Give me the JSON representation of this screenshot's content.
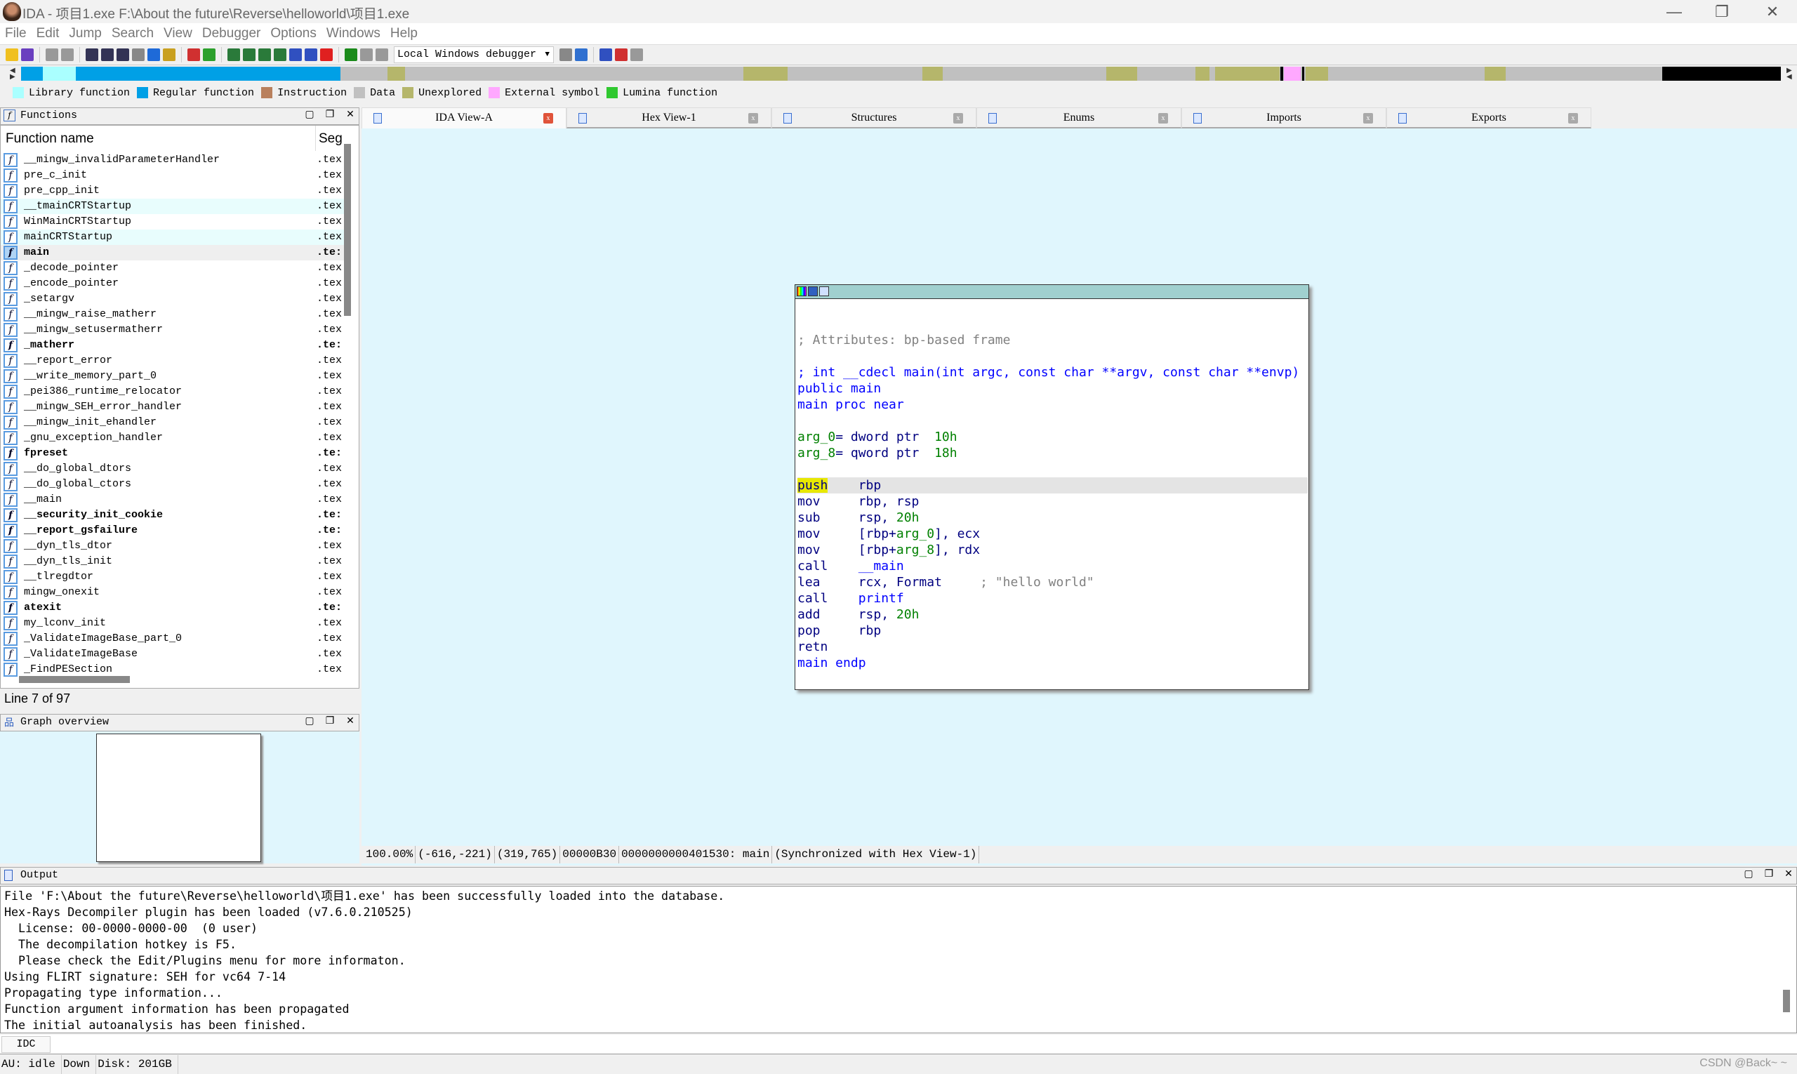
{
  "window": {
    "title": "IDA - 项目1.exe F:\\About the future\\Reverse\\helloworld\\项目1.exe",
    "minimize": "—",
    "restore": "❐",
    "close": "✕"
  },
  "menu": [
    "File",
    "Edit",
    "Jump",
    "Search",
    "View",
    "Debugger",
    "Options",
    "Windows",
    "Help"
  ],
  "toolbar": {
    "debugger_select": "Local Windows debugger",
    "icons": [
      {
        "name": "open-icon",
        "color": "#f0c020"
      },
      {
        "name": "save-icon",
        "color": "#6a3fbf"
      },
      {
        "sep": true
      },
      {
        "name": "back-icon",
        "color": "#999"
      },
      {
        "name": "forward-icon",
        "color": "#999"
      },
      {
        "sep": true
      },
      {
        "name": "text-search-icon",
        "color": "#335"
      },
      {
        "name": "binary-search-icon",
        "color": "#335"
      },
      {
        "name": "immediate-search-icon",
        "color": "#335"
      },
      {
        "name": "search-next-icon",
        "color": "#888"
      },
      {
        "name": "jump-down-icon",
        "color": "#1e6ad8"
      },
      {
        "name": "find-icon",
        "color": "#c9a020"
      },
      {
        "sep": true
      },
      {
        "name": "strings-icon",
        "color": "#d03030"
      },
      {
        "name": "run-icon",
        "color": "#2ca02c"
      },
      {
        "sep": true
      },
      {
        "name": "make-code-icon",
        "color": "#2a7a3a"
      },
      {
        "name": "make-data-icon",
        "color": "#2a7a3a"
      },
      {
        "name": "make-ascii-icon",
        "color": "#2a7a3a"
      },
      {
        "name": "make-array-icon",
        "color": "#2a7a3a"
      },
      {
        "name": "define-struct-icon",
        "color": "#3050c0"
      },
      {
        "name": "edit-icon",
        "color": "#3050c0"
      },
      {
        "name": "undefine-icon",
        "color": "#e02020"
      },
      {
        "sep": true
      },
      {
        "name": "play-icon",
        "color": "#1a8a1a"
      },
      {
        "name": "pause-icon",
        "color": "#999"
      },
      {
        "name": "stop-icon",
        "color": "#999"
      }
    ],
    "icons_right": [
      {
        "name": "attach-icon",
        "color": "#888"
      },
      {
        "name": "step-icon",
        "color": "#3070d0"
      },
      {
        "sep": true
      },
      {
        "name": "breakpoints-icon",
        "color": "#3050c0"
      },
      {
        "name": "add-breakpoint-icon",
        "color": "#d03030"
      },
      {
        "name": "delete-breakpoint-icon",
        "color": "#999"
      }
    ]
  },
  "legend": [
    {
      "label": "Library function",
      "color": "#aaffff"
    },
    {
      "label": "Regular function",
      "color": "#00a0e6"
    },
    {
      "label": "Instruction",
      "color": "#b9805d"
    },
    {
      "label": "Data",
      "color": "#c0c0c0"
    },
    {
      "label": "Unexplored",
      "color": "#b5b66b"
    },
    {
      "label": "External symbol",
      "color": "#ffa8ff"
    },
    {
      "label": "Lumina function",
      "color": "#30c830"
    }
  ],
  "functions": {
    "title": "Functions",
    "col_name": "Function name",
    "col_seg": "Seg",
    "status": "Line 7 of 97",
    "rows": [
      {
        "name": "__mingw_invalidParameterHandler",
        "seg": ".tex"
      },
      {
        "name": "pre_c_init",
        "seg": ".tex"
      },
      {
        "name": "pre_cpp_init",
        "seg": ".tex"
      },
      {
        "name": "__tmainCRTStartup",
        "seg": ".tex",
        "lib": true
      },
      {
        "name": "WinMainCRTStartup",
        "seg": ".tex"
      },
      {
        "name": "mainCRTStartup",
        "seg": ".tex",
        "lib": true
      },
      {
        "name": "main",
        "seg": ".te:",
        "bold": true,
        "selected": true
      },
      {
        "name": "_decode_pointer",
        "seg": ".tex"
      },
      {
        "name": "_encode_pointer",
        "seg": ".tex"
      },
      {
        "name": "_setargv",
        "seg": ".tex"
      },
      {
        "name": "__mingw_raise_matherr",
        "seg": ".tex"
      },
      {
        "name": "__mingw_setusermatherr",
        "seg": ".tex"
      },
      {
        "name": "_matherr",
        "seg": ".te:",
        "bold": true
      },
      {
        "name": "__report_error",
        "seg": ".tex"
      },
      {
        "name": "__write_memory_part_0",
        "seg": ".tex"
      },
      {
        "name": "_pei386_runtime_relocator",
        "seg": ".tex"
      },
      {
        "name": "__mingw_SEH_error_handler",
        "seg": ".tex"
      },
      {
        "name": "__mingw_init_ehandler",
        "seg": ".tex"
      },
      {
        "name": "_gnu_exception_handler",
        "seg": ".tex"
      },
      {
        "name": "fpreset",
        "seg": ".te:",
        "bold": true
      },
      {
        "name": "__do_global_dtors",
        "seg": ".tex"
      },
      {
        "name": "__do_global_ctors",
        "seg": ".tex"
      },
      {
        "name": "__main",
        "seg": ".tex"
      },
      {
        "name": "__security_init_cookie",
        "seg": ".te:",
        "bold": true
      },
      {
        "name": "__report_gsfailure",
        "seg": ".te:",
        "bold": true
      },
      {
        "name": "__dyn_tls_dtor",
        "seg": ".tex"
      },
      {
        "name": "__dyn_tls_init",
        "seg": ".tex"
      },
      {
        "name": "__tlregdtor",
        "seg": ".tex"
      },
      {
        "name": "mingw_onexit",
        "seg": ".tex"
      },
      {
        "name": "atexit",
        "seg": ".te:",
        "bold": true
      },
      {
        "name": "my_lconv_init",
        "seg": ".tex"
      },
      {
        "name": "_ValidateImageBase_part_0",
        "seg": ".tex"
      },
      {
        "name": "_ValidateImageBase",
        "seg": ".tex"
      },
      {
        "name": "_FindPESection",
        "seg": ".tex"
      }
    ]
  },
  "graph_overview": {
    "title": "Graph overview"
  },
  "tabs": [
    {
      "label": "IDA View-A",
      "active": true
    },
    {
      "label": "Hex View-1"
    },
    {
      "label": "Structures"
    },
    {
      "label": "Enums"
    },
    {
      "label": "Imports"
    },
    {
      "label": "Exports"
    }
  ],
  "tab_close": "x",
  "code": [
    [],
    [],
    [
      {
        "t": "; Attributes: bp-based frame",
        "c": "cm"
      }
    ],
    [],
    [
      {
        "t": "; int __cdecl main(int argc, const char **argv, const char **envp)",
        "c": "bl"
      }
    ],
    [
      {
        "t": "public main",
        "c": "bl"
      }
    ],
    [
      {
        "t": "main proc near",
        "c": "bl"
      }
    ],
    [],
    [
      {
        "t": "arg_0",
        "c": "gr"
      },
      {
        "t": "= dword ptr  ",
        "c": "k"
      },
      {
        "t": "10h",
        "c": "gr"
      }
    ],
    [
      {
        "t": "arg_8",
        "c": "gr"
      },
      {
        "t": "= qword ptr  ",
        "c": "k"
      },
      {
        "t": "18h",
        "c": "gr"
      }
    ],
    [],
    [
      {
        "t": "push",
        "c": "hl"
      },
      {
        "t": "    rbp",
        "c": "k"
      }
    ],
    [
      {
        "t": "mov     rbp, rsp",
        "c": "k"
      }
    ],
    [
      {
        "t": "sub     rsp, ",
        "c": "k"
      },
      {
        "t": "20h",
        "c": "gr"
      }
    ],
    [
      {
        "t": "mov     [rbp+",
        "c": "k"
      },
      {
        "t": "arg_0",
        "c": "gr"
      },
      {
        "t": "], ecx",
        "c": "k"
      }
    ],
    [
      {
        "t": "mov     [rbp+",
        "c": "k"
      },
      {
        "t": "arg_8",
        "c": "gr"
      },
      {
        "t": "], rdx",
        "c": "k"
      }
    ],
    [
      {
        "t": "call    ",
        "c": "k"
      },
      {
        "t": "__main",
        "c": "bl"
      }
    ],
    [
      {
        "t": "lea     rcx, Format     ",
        "c": "k"
      },
      {
        "t": "; \"hello world\"",
        "c": "cm"
      }
    ],
    [
      {
        "t": "call    ",
        "c": "k"
      },
      {
        "t": "printf",
        "c": "bl"
      }
    ],
    [
      {
        "t": "add     rsp, ",
        "c": "k"
      },
      {
        "t": "20h",
        "c": "gr"
      }
    ],
    [
      {
        "t": "pop     rbp",
        "c": "k"
      }
    ],
    [
      {
        "t": "retn",
        "c": "k"
      }
    ],
    [
      {
        "t": "main endp",
        "c": "bl"
      }
    ]
  ],
  "graph_status": [
    "100.00%",
    "(-616,-221)",
    "(319,765)",
    "00000B30",
    "0000000000401530: main",
    "(Synchronized with Hex View-1)"
  ],
  "output": {
    "title": "Output",
    "lines": [
      "File 'F:\\About the future\\Reverse\\helloworld\\项目1.exe' has been successfully loaded into the database.",
      "Hex-Rays Decompiler plugin has been loaded (v7.6.0.210525)",
      "  License: 00-0000-0000-00  (0 user)",
      "  The decompilation hotkey is F5.",
      "  Please check the Edit/Plugins menu for more informaton.",
      "Using FLIRT signature: SEH for vc64 7-14",
      "Propagating type information...",
      "Function argument information has been propagated",
      "The initial autoanalysis has been finished."
    ],
    "idc_label": "IDC"
  },
  "statusbar": {
    "au": "AU:  idle",
    "dir": "Down",
    "disk": "Disk: 201GB"
  },
  "watermark": "CSDN @Back~ ~"
}
